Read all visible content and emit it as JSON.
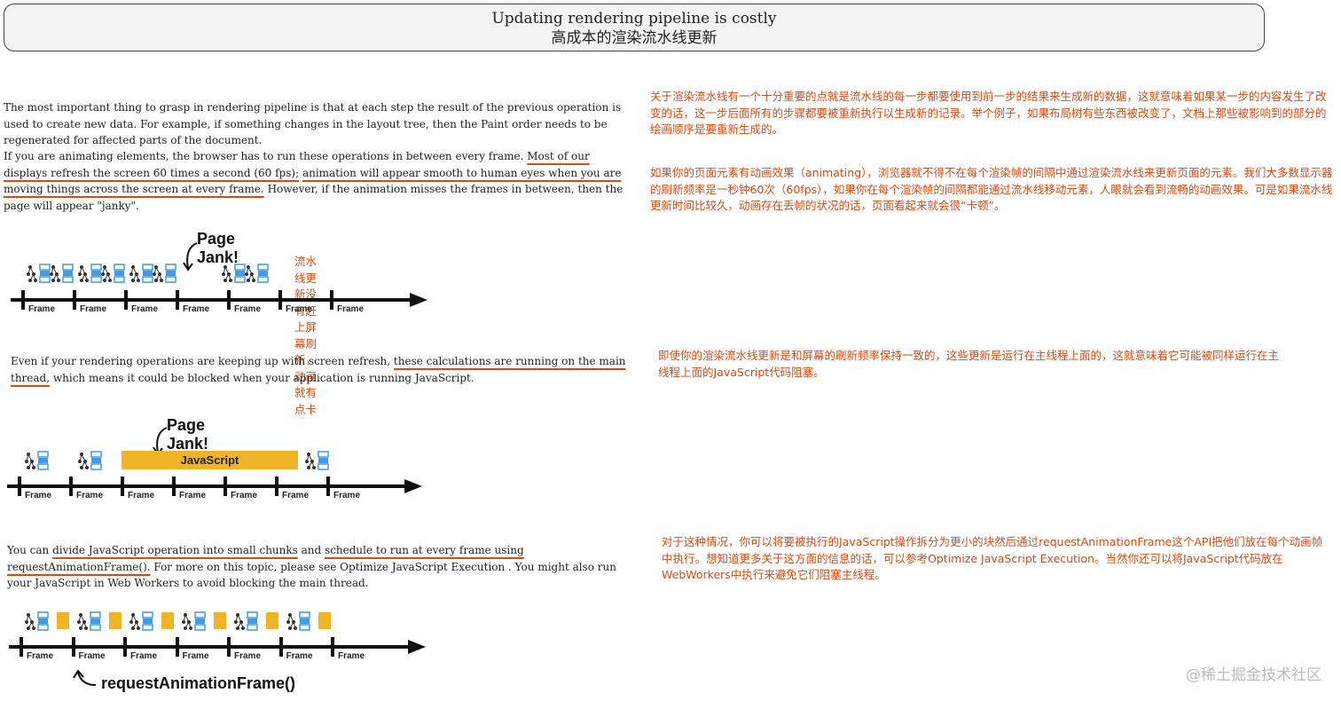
{
  "title": {
    "en": "Updating rendering pipeline is costly",
    "zh": "高成本的渲染流水线更新"
  },
  "section1": {
    "en_p1": "The most important thing to grasp in rendering pipeline is that at each step the result of the previous operation is used to create new data. For example, if something changes in the layout tree, then the Paint order needs to be regenerated for affected parts of the document.",
    "en_p2_a": "If you are animating elements, the browser has to run these operations in between every frame. ",
    "en_p2_u1": "Most of our displays refresh the screen 60 times a second (60 fps);",
    "en_p2_b": " ",
    "en_p2_u2": "animation will appear smooth to human eyes when you are moving things across the screen at every frame.",
    "en_p2_c": " However, if the animation misses the frames in between, then the page will appear \"janky\".",
    "zh_p1": "关于渲染流水线有一个十分重要的点就是流水线的每一步都要使用到前一步的结果来生成新的数据，这就意味着如果某一步的内容发生了改变的话，这一步后面所有的步骤都要被重新执行以生成新的记录。举个例子，如果布局树有些东西被改变了，文档上那些被影响到的部分的绘画顺序是要重新生成的。",
    "zh_p2": "如果你的页面元素有动画效果（animating），浏览器就不得不在每个渲染帧的间隔中通过渲染流水线来更新页面的元素。我们大多数显示器的刷新频率是一秒钟60次（60fps），如果你在每个渲染帧的间隔都能通过流水线移动元素，人眼就会看到流畅的动画效果。可是如果流水线更新时间比较久，动画存在丢帧的状况的话，页面看起来就会很“卡顿”。"
  },
  "diagram1": {
    "jank_label": "Page Jank!",
    "note_zh": "流水线更新没有赶上屏幕刷新，动画就有点卡",
    "frames": [
      "Frame",
      "Frame",
      "Frame",
      "Frame",
      "Frame",
      "Frame",
      "Frame"
    ]
  },
  "section2": {
    "en_a": "Even if your rendering operations are keeping up with screen refresh, ",
    "en_u": "these calculations are running on the main thread,",
    "en_b": " which means it could be blocked when your application is running JavaScript.",
    "zh": "即使你的渲染流水线更新是和屏幕的刷新频率保持一致的，这些更新是运行在主线程上面的，这就意味着它可能被同样运行在主线程上面的JavaScript代码阻塞。"
  },
  "diagram2": {
    "jank_label": "Page Jank!",
    "js_label": "JavaScript",
    "frames": [
      "Frame",
      "Frame",
      "Frame",
      "Frame",
      "Frame",
      "Frame",
      "Frame"
    ]
  },
  "section3": {
    "en_a": "You can ",
    "en_u1": "divide JavaScript operation into small chunks",
    "en_b": " and ",
    "en_u2": "schedule to run at every frame using requestAnimationFrame().",
    "en_c": " For more on this topic, please see Optimize JavaScript Execution . You might also run your JavaScript in Web Workers to avoid blocking the main thread.",
    "zh": "对于这种情况，你可以将要被执行的JavaScript操作拆分为更小的块然后通过requestAnimationFrame这个API把他们放在每个动画帧中执行。想知道更多关于这方面的信息的话，可以参考Optimize JavaScript Execution。当然你还可以将JavaScript代码放在WebWorkers中执行来避免它们阻塞主线程。"
  },
  "diagram3": {
    "raf_label": "requestAnimationFrame()",
    "frames": [
      "Frame",
      "Frame",
      "Frame",
      "Frame",
      "Frame",
      "Frame",
      "Frame"
    ]
  },
  "watermark": "@稀土掘金技术社区",
  "colors": {
    "accent": "#d64b12",
    "js": "#f0b429",
    "icon_blue": "#3d9be9",
    "icon_dark": "#333333"
  }
}
